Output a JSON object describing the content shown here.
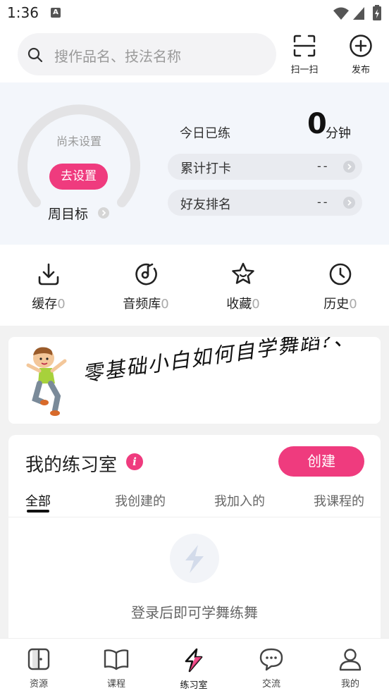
{
  "status": {
    "time": "1:36",
    "notif_icon": "A"
  },
  "search": {
    "placeholder": "搜作品名、技法名称"
  },
  "header_actions": [
    {
      "label": "扫一扫",
      "icon": "scan-icon"
    },
    {
      "label": "发布",
      "icon": "plus-circle-icon"
    }
  ],
  "goal": {
    "status": "尚未设置",
    "set_label": "去设置",
    "week_label": "周目标",
    "today_label": "今日已练",
    "today_value": "0",
    "today_unit": "分钟",
    "checkin_label": "累计打卡",
    "checkin_value": "--",
    "rank_label": "好友排名",
    "rank_value": "--"
  },
  "quick": [
    {
      "label": "缓存",
      "count": "0",
      "icon": "download-icon"
    },
    {
      "label": "音频库",
      "count": "0",
      "icon": "music-disc-icon"
    },
    {
      "label": "收藏",
      "count": "0",
      "icon": "star-icon"
    },
    {
      "label": "历史",
      "count": "0",
      "icon": "clock-icon"
    }
  ],
  "banner": {
    "text": "零基础小白如何自学舞蹈?、",
    "page_count": 4,
    "active_index": 3
  },
  "room": {
    "title": "我的练习室",
    "create_label": "创建",
    "tabs": [
      "全部",
      "我创建的",
      "我加入的",
      "我课程的"
    ],
    "active_tab": 0,
    "empty_text": "登录后即可学舞练舞"
  },
  "nav": [
    {
      "label": "资源",
      "icon": "resource-icon"
    },
    {
      "label": "课程",
      "icon": "book-icon"
    },
    {
      "label": "练习室",
      "icon": "bolt-icon",
      "active": true
    },
    {
      "label": "交流",
      "icon": "chat-icon"
    },
    {
      "label": "我的",
      "icon": "user-icon"
    }
  ],
  "colors": {
    "accent": "#ef3b7e",
    "panel_bg": "#f3f6fb"
  }
}
